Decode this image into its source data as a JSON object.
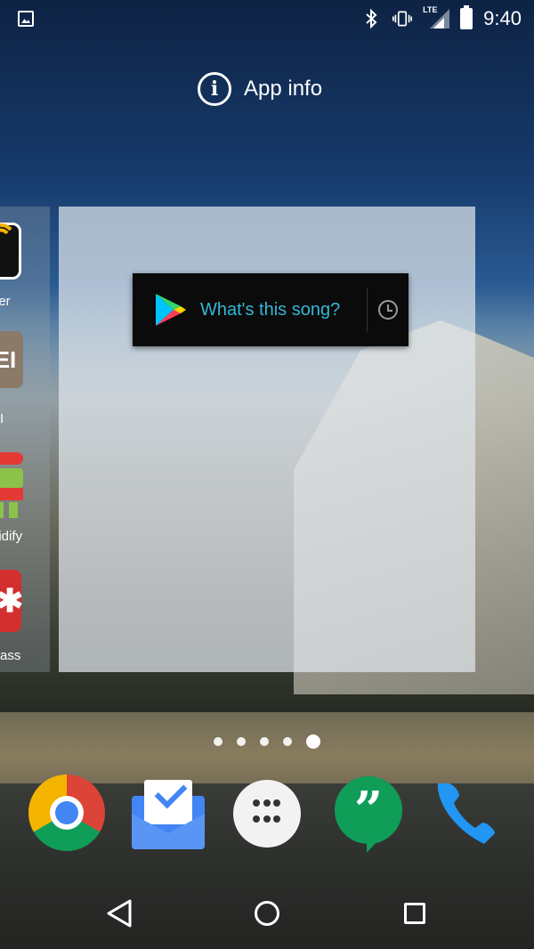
{
  "status_bar": {
    "time": "9:40",
    "network": "LTE",
    "icons": [
      "image-notification-icon",
      "bluetooth-icon",
      "vibrate-icon",
      "lte-signal-icon",
      "battery-icon"
    ]
  },
  "app_info": {
    "label": "App info",
    "icon": "info-icon"
  },
  "left_page_preview": {
    "items": [
      {
        "label": "ger",
        "icon": "app-icon-1"
      },
      {
        "label": "EI",
        "icon_text": "EI"
      },
      {
        "label": "oidify",
        "icon": "android-app-icon"
      },
      {
        "label": "Pass",
        "icon": "lastpass-icon"
      }
    ]
  },
  "widget": {
    "text": "What's this song?",
    "play_icon": "google-play-icon",
    "history_icon": "clock-icon"
  },
  "page_indicator": {
    "count": 5,
    "active_index": 4
  },
  "dock": {
    "apps": [
      {
        "name": "Chrome"
      },
      {
        "name": "Inbox"
      },
      {
        "name": "Apps"
      },
      {
        "name": "Hangouts",
        "glyph": "”"
      },
      {
        "name": "Phone"
      }
    ]
  },
  "nav_bar": {
    "buttons": [
      "back",
      "home",
      "recents"
    ]
  }
}
